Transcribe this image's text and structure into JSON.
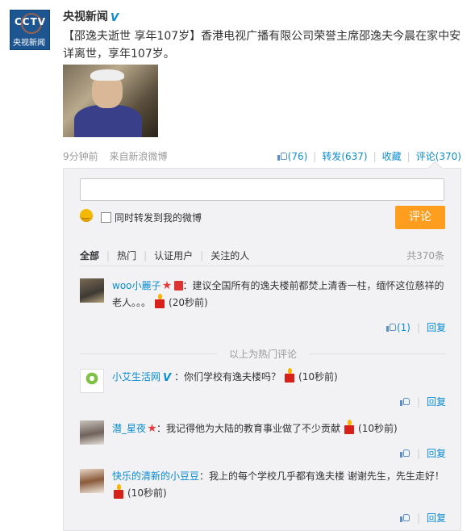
{
  "post": {
    "author": "央视新闻",
    "avatar_text": "CCTV",
    "avatar_sub": "央视新闻",
    "verified_icon": "V",
    "text": "【邵逸夫逝世 享年107岁】香港电视广播有限公司荣誉主席邵逸夫今晨在家中安详离世，享年107岁。",
    "time": "9分钟前",
    "source": "来自新浪微博",
    "likes": "(76)",
    "repost": "转发(637)",
    "favorite": "收藏",
    "comment": "评论(370)"
  },
  "comment_box": {
    "checkbox_label": "同时转发到我的微博",
    "submit_label": "评论",
    "tabs": [
      "全部",
      "热门",
      "认证用户",
      "关注的人"
    ],
    "total": "共370条",
    "hot_divider": "以上为热门评论"
  },
  "comments": [
    {
      "name": "woo小麗子",
      "text": "：建议全国所有的逸夫楼前都焚上清香一柱，缅怀这位慈祥的老人。。。",
      "time": "(20秒前)",
      "like": "(1)",
      "reply": "回复"
    },
    {
      "name": "小艾生活网",
      "text": "：你们学校有逸夫楼吗？",
      "time": "(10秒前)",
      "reply": "回复"
    },
    {
      "name": "潜_星夜",
      "text": "：我记得他为大陆的教育事业做了不少贡献",
      "time": "(10秒前)",
      "reply": "回复"
    },
    {
      "name": "快乐的清新的小豆豆",
      "text": "：我上的每个学校几乎都有逸夫楼 谢谢先生，先生走好！",
      "time": "(10秒前)",
      "reply": "回复"
    }
  ],
  "colors": {
    "link": "#0a8cd2",
    "button": "#ff9d1e",
    "panel": "#f2f2f5"
  }
}
